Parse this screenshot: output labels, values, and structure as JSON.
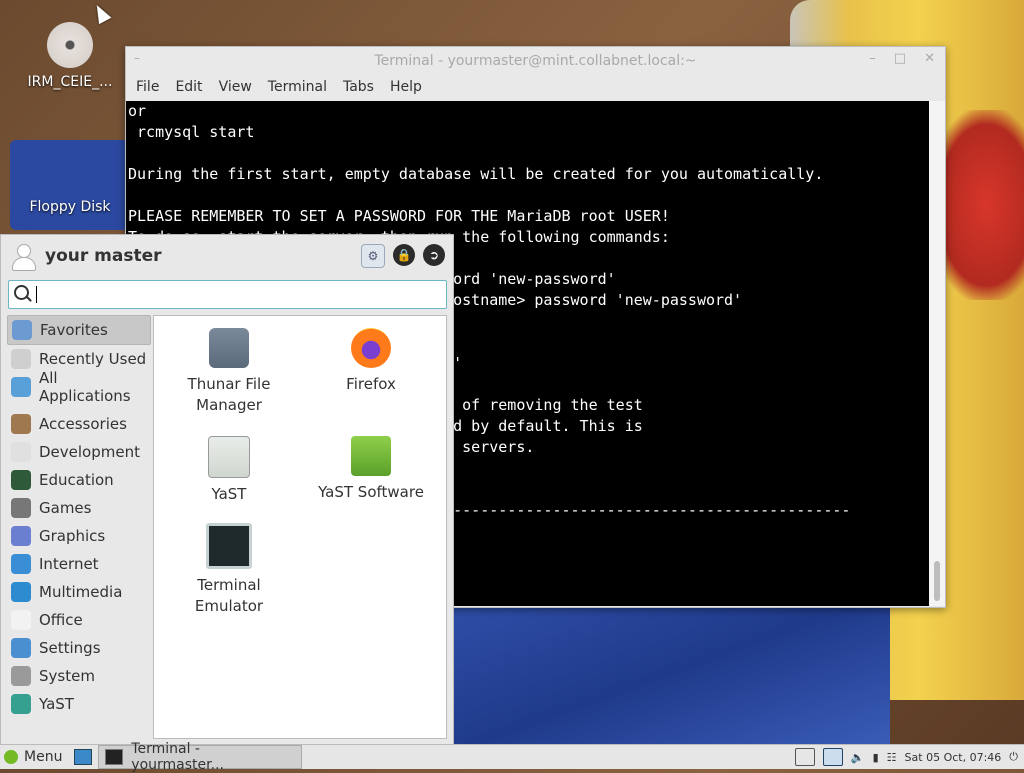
{
  "desktop": {
    "icons": [
      {
        "label": "IRM_CEIE_..."
      },
      {
        "label": "Floppy Disk"
      }
    ]
  },
  "terminal": {
    "title": "Terminal - yourmaster@mint.collabnet.local:~",
    "menu": [
      "File",
      "Edit",
      "View",
      "Terminal",
      "Tabs",
      "Help"
    ],
    "lines": [
      "or",
      " rcmysql start",
      "",
      "During the first start, empty database will be created for you automatically.",
      "",
      "PLEASE REMEMBER TO SET A PASSWORD FOR THE MariaDB root USER!",
      "To do so, start the server, then run the following commands:",
      "",
      "                                 ssword 'new-password'",
      "                                  <hostname> password 'new-password'",
      "",
      "",
      "                                 ion'",
      "",
      "                                 ion of removing the test",
      "                                 ated by default. This is",
      "                                 ion servers.",
      "",
      "",
      "                                 -----------------------------------------------"
    ]
  },
  "menu": {
    "user_name": "your master",
    "search_placeholder": "",
    "categories": [
      {
        "label": "Favorites",
        "icon": "favorites-icon",
        "color": "#6b9bd1",
        "selected": true
      },
      {
        "label": "Recently Used",
        "icon": "recent-icon",
        "color": "#cfcfcf"
      },
      {
        "label": "All Applications",
        "icon": "all-apps-icon",
        "color": "#5aa0d8"
      },
      {
        "label": "Accessories",
        "icon": "accessories-icon",
        "color": "#a07850"
      },
      {
        "label": "Development",
        "icon": "development-icon",
        "color": "#e0e0e0"
      },
      {
        "label": "Education",
        "icon": "education-icon",
        "color": "#2f5a3a"
      },
      {
        "label": "Games",
        "icon": "games-icon",
        "color": "#777777"
      },
      {
        "label": "Graphics",
        "icon": "graphics-icon",
        "color": "#6a7fd0"
      },
      {
        "label": "Internet",
        "icon": "internet-icon",
        "color": "#3a8ed6"
      },
      {
        "label": "Multimedia",
        "icon": "multimedia-icon",
        "color": "#2d8bd0"
      },
      {
        "label": "Office",
        "icon": "office-icon",
        "color": "#f2f2f2"
      },
      {
        "label": "Settings",
        "icon": "settings-icon",
        "color": "#4a8fd0"
      },
      {
        "label": "System",
        "icon": "system-icon",
        "color": "#9a9a9a"
      },
      {
        "label": "YaST",
        "icon": "yast-icon",
        "color": "#35a090"
      }
    ],
    "apps": [
      {
        "label": "Thunar File\nManager",
        "icon": "thunar-icon"
      },
      {
        "label": "Firefox",
        "icon": "firefox-icon"
      },
      {
        "label": "YaST",
        "icon": "yast-app-icon"
      },
      {
        "label": "YaST Software",
        "icon": "yast-software-icon"
      },
      {
        "label": "Terminal\nEmulator",
        "icon": "terminal-icon"
      }
    ]
  },
  "taskbar": {
    "menu_label": "Menu",
    "task_label": "Terminal - yourmaster...",
    "clock": "Sat 05 Oct, 07:46"
  }
}
